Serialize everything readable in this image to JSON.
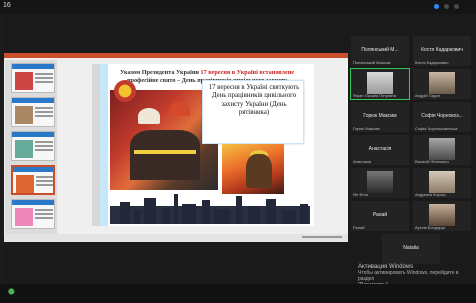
{
  "window": {
    "indicator": "16"
  },
  "slide": {
    "title_prefix": "Указом Президента України ",
    "title_highlight": "17 вересня в Україні встановлене",
    "title_suffix": " професійне свято – День працівників цивільного захисту",
    "callout": "17 вересня в Україні святкують День працівників цивільного захисту України (День рятівника)"
  },
  "participants": [
    {
      "name": "Полянський  М...",
      "caption": "Полянський Максим"
    },
    {
      "name": "Костя Кадаркович",
      "caption": "Костя Кадаркович"
    },
    {
      "name": "",
      "caption": "Фіран Оксана Петрівна"
    },
    {
      "name": "",
      "caption": "Андрій Тидин"
    },
    {
      "name": "Горюк Максим",
      "caption": "Горюк Максим"
    },
    {
      "name": "Софія  Чорнокоз...",
      "caption": "Софія Чорнокозинська"
    },
    {
      "name": "Анастасія",
      "caption": "Анастасія"
    },
    {
      "name": "",
      "caption": "Василій Філіпович"
    },
    {
      "name": "",
      "caption": "Ян Фітю"
    },
    {
      "name": "",
      "caption": "Андріана Корогр"
    },
    {
      "name": "Ранай",
      "caption": "Ранай"
    },
    {
      "name": "",
      "caption": "Артем Бондарук"
    },
    {
      "name": "Natalia",
      "caption": ""
    }
  ],
  "activation": {
    "heading": "Активация Windows",
    "line1": "Чтобы активировать Windows, перейдите в раздел",
    "line2": "\"Параметры\"."
  },
  "colors": {
    "accent_blue": "#2d8cff",
    "ppt_orange": "#c94f2a",
    "active_green": "#34c759"
  }
}
